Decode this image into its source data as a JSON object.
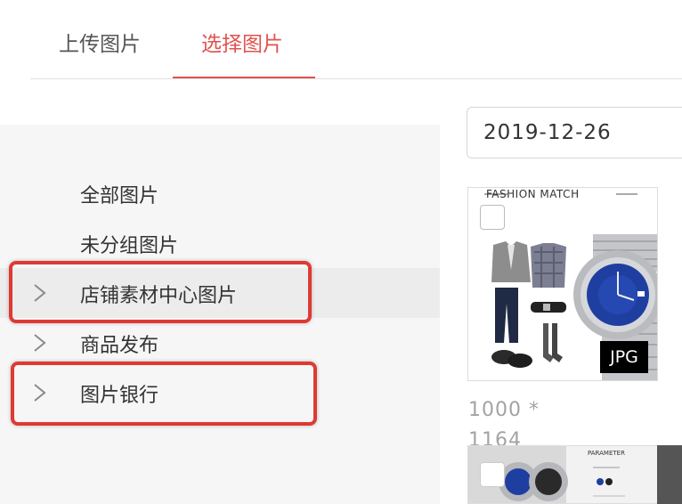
{
  "tabs": [
    {
      "label": "上传图片",
      "active": false
    },
    {
      "label": "选择图片",
      "active": true
    }
  ],
  "accent_color": "#e0524f",
  "sidebar": {
    "items": [
      {
        "label": "全部图片",
        "has_chevron": false
      },
      {
        "label": "未分组图片",
        "has_chevron": false
      },
      {
        "label": "店铺素材中心图片",
        "has_chevron": true,
        "active": true,
        "highlighted": true
      },
      {
        "label": "商品发布",
        "has_chevron": true
      },
      {
        "label": "图片银行",
        "has_chevron": true,
        "highlighted": true
      }
    ]
  },
  "date_filter": {
    "value": "2019-12-26"
  },
  "images": [
    {
      "caption": "FASHION MATCH",
      "format": "JPG",
      "dimensions_line1": "1000 *",
      "dimensions_line2": "1164"
    },
    {
      "caption": "PARAMETER"
    }
  ],
  "highlight_color": "#de3a33"
}
